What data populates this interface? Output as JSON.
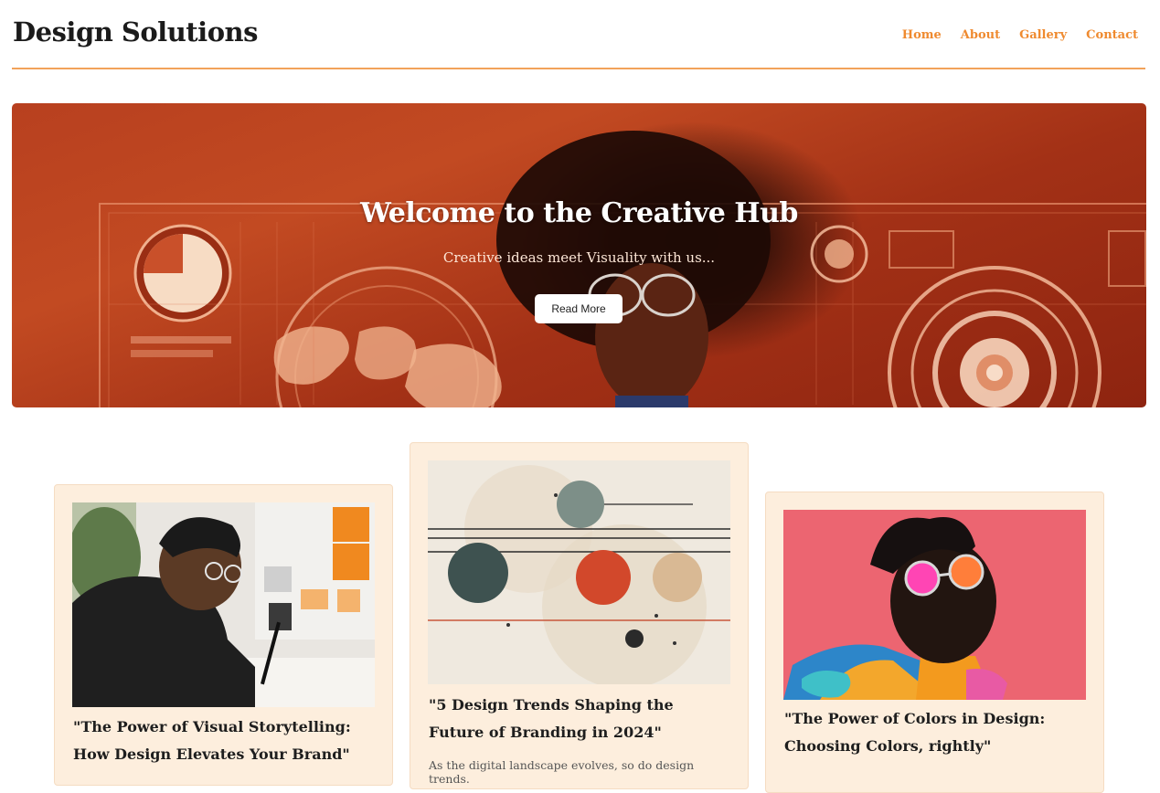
{
  "site": {
    "title": "Design Solutions"
  },
  "nav": {
    "items": [
      "Home",
      "About",
      "Gallery",
      "Contact"
    ]
  },
  "hero": {
    "title": "Welcome to the Creative Hub",
    "subtitle": "Creative ideas meet Visuality with us...",
    "button_label": "Read More"
  },
  "cards": [
    {
      "title": "\"The Power of Visual Storytelling: How Design Elevates Your Brand\"",
      "text": ""
    },
    {
      "title": "\"5 Design Trends Shaping the Future of Branding in 2024\"",
      "text": "As the digital landscape evolves, so do design trends."
    },
    {
      "title": "\"The Power of Colors in Design: Choosing Colors, rightly\"",
      "text": ""
    }
  ],
  "colors": {
    "accent": "#ef8a2f",
    "card_bg": "#fdeedd",
    "hero": "#b8401f"
  }
}
